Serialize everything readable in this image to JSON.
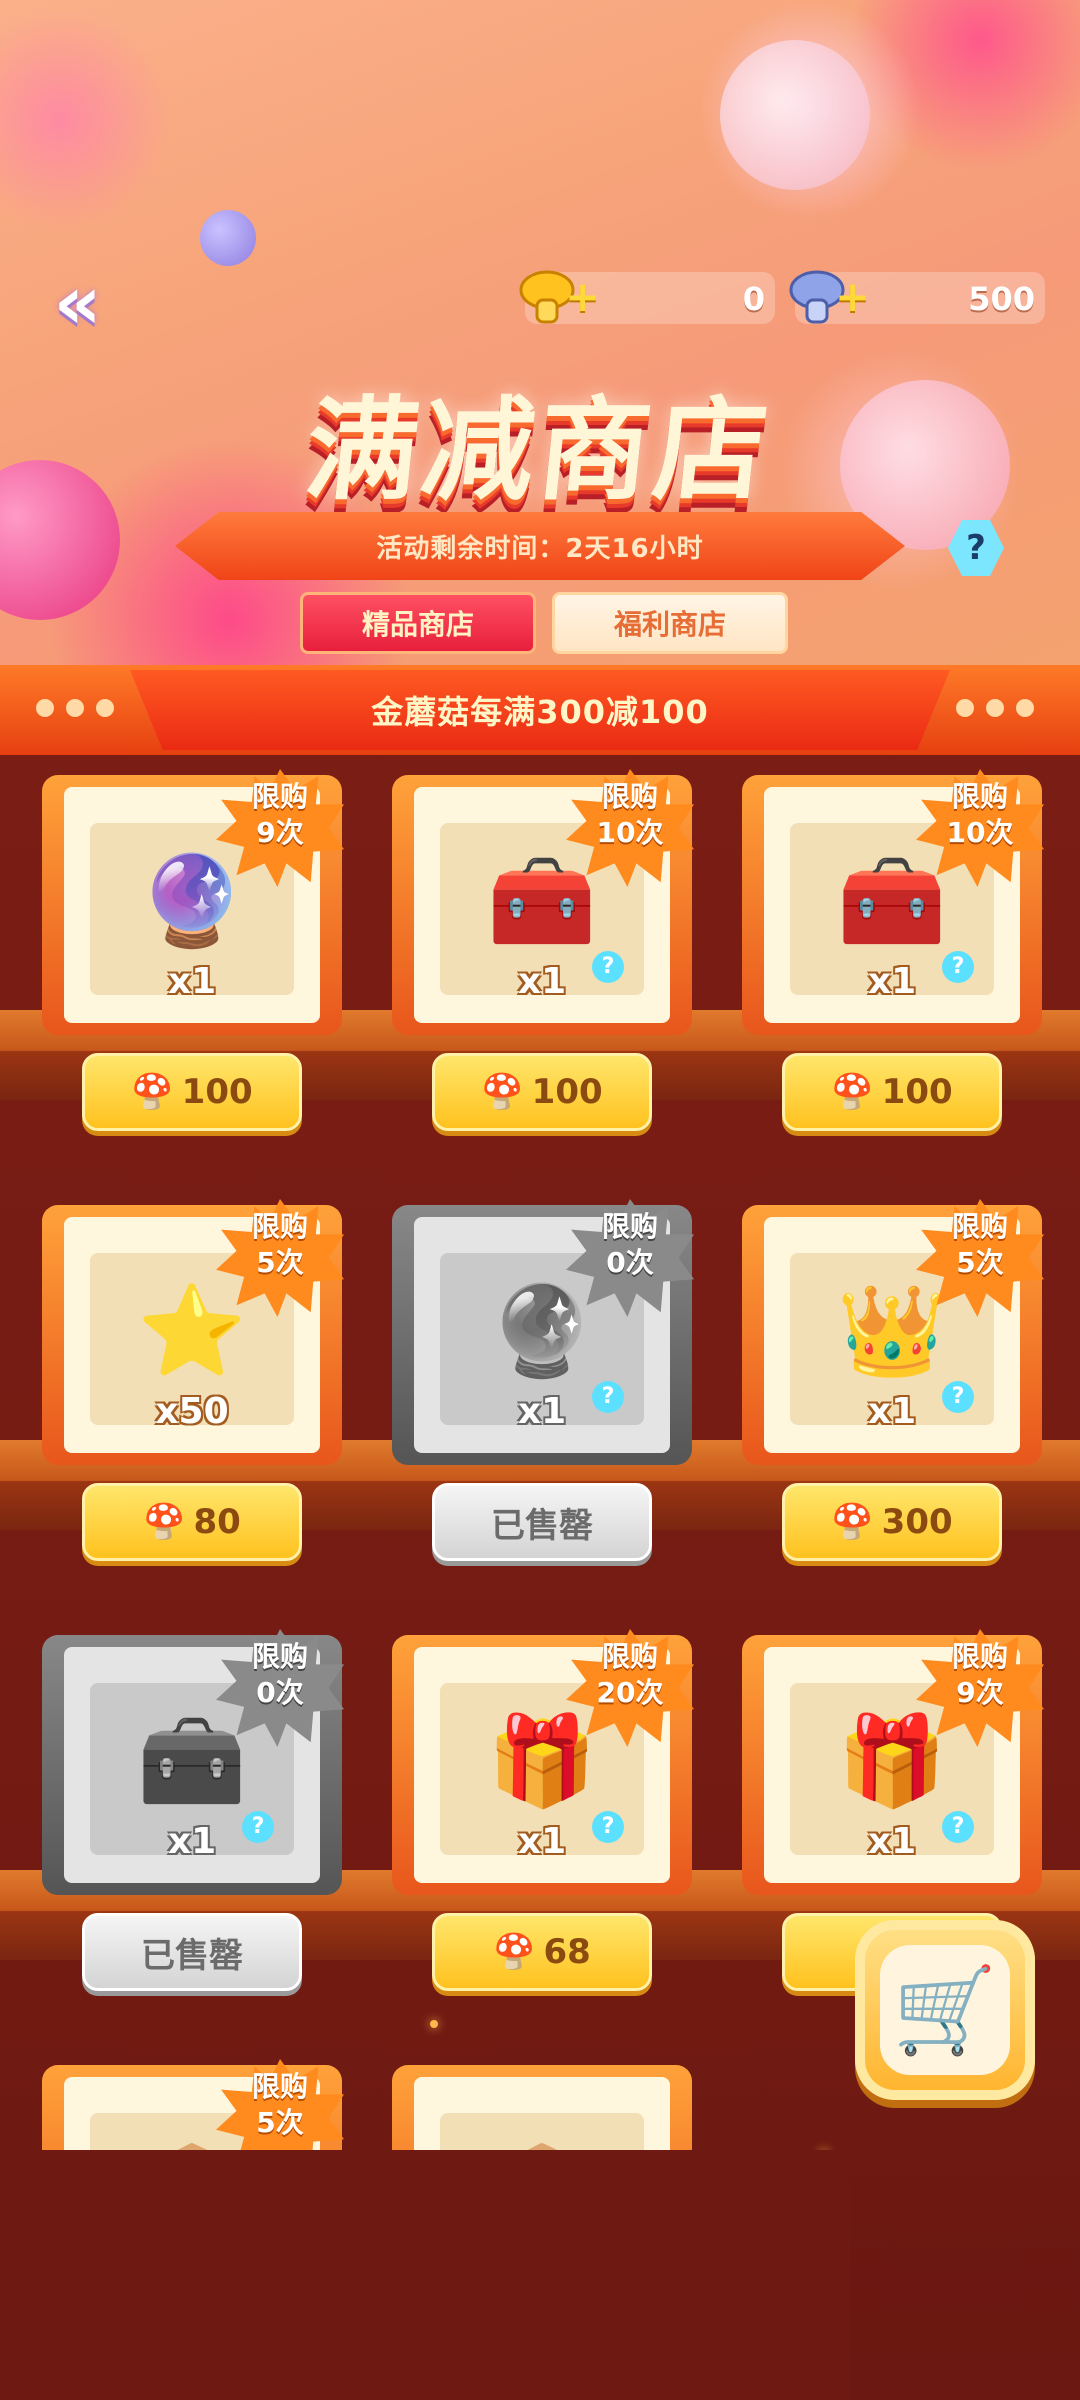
{
  "header": {
    "title": "满减商店",
    "countdown": "活动剩余时间：2天16小时",
    "help_icon_label": "?",
    "back_icon": "double-chevron-left-icon",
    "gold_mushroom": {
      "icon": "gold-mushroom-icon",
      "amount": "0"
    },
    "silver_mushroom": {
      "icon": "silver-mushroom-icon",
      "amount": "500"
    }
  },
  "tabs": [
    {
      "label": "精品商店",
      "active": true
    },
    {
      "label": "福利商店",
      "active": false
    }
  ],
  "promo": {
    "text": "金蘑菇每满300减100"
  },
  "items": [
    {
      "icon": "crystal-orb-icon",
      "qty": "x1",
      "limit_line1": "限购",
      "limit_line2": "9次",
      "price": "100",
      "sold_out": false,
      "info": false
    },
    {
      "icon": "gold-red-chest-icon",
      "qty": "x1",
      "limit_line1": "限购",
      "limit_line2": "10次",
      "price": "100",
      "sold_out": false,
      "info": true
    },
    {
      "icon": "gold-green-chest-icon",
      "qty": "x1",
      "limit_line1": "限购",
      "limit_line2": "10次",
      "price": "100",
      "sold_out": false,
      "info": true
    },
    {
      "icon": "gold-star-icon",
      "qty": "x50",
      "limit_line1": "限购",
      "limit_line2": "5次",
      "price": "80",
      "sold_out": false,
      "info": false
    },
    {
      "icon": "silver-crystal-orb-icon",
      "qty": "x1",
      "limit_line1": "限购",
      "limit_line2": "0次",
      "price": "已售罄",
      "sold_out": true,
      "info": true
    },
    {
      "icon": "royal-gold-chest-icon",
      "qty": "x1",
      "limit_line1": "限购",
      "limit_line2": "5次",
      "price": "300",
      "sold_out": false,
      "info": true
    },
    {
      "icon": "silver-chest-icon",
      "qty": "x1",
      "limit_line1": "限购",
      "limit_line2": "0次",
      "price": "已售罄",
      "sold_out": true,
      "info": true
    },
    {
      "icon": "crown-pink-chest-icon",
      "qty": "x1",
      "limit_line1": "限购",
      "limit_line2": "20次",
      "price": "68",
      "sold_out": false,
      "info": true
    },
    {
      "icon": "crown-blue-chest-icon",
      "qty": "x1",
      "limit_line1": "限购",
      "limit_line2": "9次",
      "price": "",
      "sold_out": false,
      "info": true
    },
    {
      "icon": "partial-item-icon",
      "qty": "",
      "limit_line1": "限购",
      "limit_line2": "5次",
      "price": "",
      "sold_out": false,
      "info": false
    },
    {
      "icon": "partial-item-icon",
      "qty": "",
      "limit_line1": "",
      "limit_line2": "",
      "price": "",
      "sold_out": false,
      "info": false
    }
  ],
  "cart": {
    "icon": "shopping-cart-icon"
  },
  "colors": {
    "accent_red": "#e81f3c",
    "gold": "#ffc21f",
    "shelf": "#c8581b",
    "leaf": "#ff8a1e"
  }
}
